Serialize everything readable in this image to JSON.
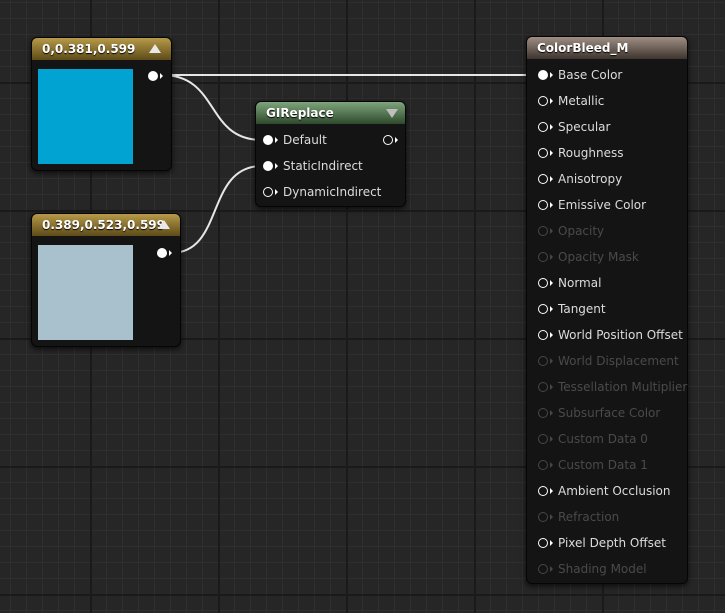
{
  "nodes": {
    "constant_1": {
      "title": "0,0.381,0.599",
      "color": "#00a3d1",
      "rgb": [
        0,
        0.381,
        0.599
      ]
    },
    "constant_2": {
      "title": "0.389,0.523,0.599",
      "color": "#a9c1cd",
      "rgb": [
        0.389,
        0.523,
        0.599
      ]
    },
    "gi_replace": {
      "title": "GIReplace",
      "inputs": [
        "Default",
        "StaticIndirect",
        "DynamicIndirect"
      ]
    },
    "material": {
      "title": "ColorBleed_M",
      "inputs": [
        {
          "label": "Base Color",
          "enabled": true,
          "connected": true
        },
        {
          "label": "Metallic",
          "enabled": true,
          "connected": false
        },
        {
          "label": "Specular",
          "enabled": true,
          "connected": false
        },
        {
          "label": "Roughness",
          "enabled": true,
          "connected": false
        },
        {
          "label": "Anisotropy",
          "enabled": true,
          "connected": false
        },
        {
          "label": "Emissive Color",
          "enabled": true,
          "connected": false
        },
        {
          "label": "Opacity",
          "enabled": false,
          "connected": false
        },
        {
          "label": "Opacity Mask",
          "enabled": false,
          "connected": false
        },
        {
          "label": "Normal",
          "enabled": true,
          "connected": false
        },
        {
          "label": "Tangent",
          "enabled": true,
          "connected": false
        },
        {
          "label": "World Position Offset",
          "enabled": true,
          "connected": false
        },
        {
          "label": "World Displacement",
          "enabled": false,
          "connected": false
        },
        {
          "label": "Tessellation Multiplier",
          "enabled": false,
          "connected": false
        },
        {
          "label": "Subsurface Color",
          "enabled": false,
          "connected": false
        },
        {
          "label": "Custom Data 0",
          "enabled": false,
          "connected": false
        },
        {
          "label": "Custom Data 1",
          "enabled": false,
          "connected": false
        },
        {
          "label": "Ambient Occlusion",
          "enabled": true,
          "connected": false
        },
        {
          "label": "Refraction",
          "enabled": false,
          "connected": false
        },
        {
          "label": "Pixel Depth Offset",
          "enabled": true,
          "connected": false
        },
        {
          "label": "Shading Model",
          "enabled": false,
          "connected": false
        }
      ]
    }
  },
  "colors": {
    "grid_background": "#262626",
    "wire": "#e6e6e6",
    "disabled_text": "#4a4a4a"
  }
}
